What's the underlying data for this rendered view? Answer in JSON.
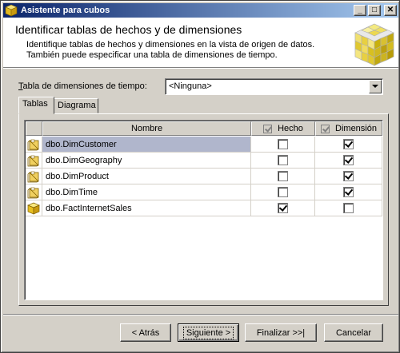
{
  "window": {
    "title": "Asistente para cubos",
    "minimize": "_",
    "maximize": "□",
    "close": "✕"
  },
  "header": {
    "title": "Identificar tablas de hechos y de dimensiones",
    "desc_line1": "Identifique tablas de hechos y dimensiones en la vista de origen de datos.",
    "desc_line2": "También puede especificar una tabla de dimensiones de tiempo.",
    "icon": "cube-icon"
  },
  "time_dimension": {
    "label_prefix": "",
    "label_access": "T",
    "label_rest": "abla de dimensiones de tiempo:",
    "value": "<Ninguna>"
  },
  "tabs": [
    {
      "label": "Tablas",
      "active": true
    },
    {
      "label": "Diagrama",
      "active": false
    }
  ],
  "table": {
    "columns": {
      "name": "Nombre",
      "fact": "Hecho",
      "dimension": "Dimensión"
    },
    "rows": [
      {
        "name": "dbo.DimCustomer",
        "fact": false,
        "dimension": true,
        "icon": "dimension-table-icon"
      },
      {
        "name": "dbo.DimGeography",
        "fact": false,
        "dimension": true,
        "icon": "dimension-table-icon"
      },
      {
        "name": "dbo.DimProduct",
        "fact": false,
        "dimension": true,
        "icon": "dimension-table-icon"
      },
      {
        "name": "dbo.DimTime",
        "fact": false,
        "dimension": true,
        "icon": "dimension-table-icon"
      },
      {
        "name": "dbo.FactInternetSales",
        "fact": true,
        "dimension": false,
        "icon": "fact-table-icon"
      }
    ]
  },
  "buttons": {
    "back": "< Atrás",
    "next": "Siguiente >",
    "finish": "Finalizar >>|",
    "cancel": "Cancelar"
  },
  "colors": {
    "titlebar_start": "#0a246a",
    "titlebar_end": "#a6caf0",
    "selection": "#b0b6cc",
    "face": "#d4d0c8"
  }
}
